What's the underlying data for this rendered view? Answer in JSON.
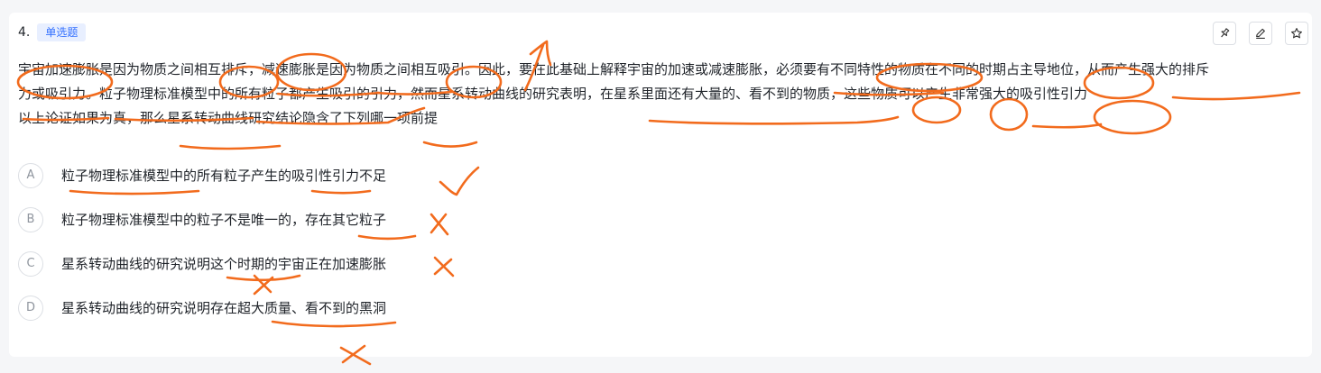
{
  "question": {
    "number": "4.",
    "type_tag": "单选题",
    "stem_lines": [
      "宇宙加速膨胀是因为物质之间相互排斥，减速膨胀是因为物质之间相互吸引。因此，要在此基础上解释宇宙的加速或减速膨胀，必须要有不同特性的物质在不同的时期占主导地位，从而产生强大的排斥",
      "力或吸引力。粒子物理标准模型中的所有粒子都产生吸引的引力，然而星系转动曲线的研究表明，在星系里面还有大量的、看不到的物质，这些物质可以产生非常强大的吸引性引力",
      "以上论证如果为真，那么星系转动曲线研究结论隐含了下列哪一项前提"
    ],
    "options": [
      {
        "letter": "A",
        "text": "粒子物理标准模型中的所有粒子产生的吸引性引力不足"
      },
      {
        "letter": "B",
        "text": "粒子物理标准模型中的粒子不是唯一的，存在其它粒子"
      },
      {
        "letter": "C",
        "text": "星系转动曲线的研究说明这个时期的宇宙正在加速膨胀"
      },
      {
        "letter": "D",
        "text": "星系转动曲线的研究说明存在超大质量、看不到的黑洞"
      }
    ]
  },
  "toolbar": {
    "icons": [
      "pin-icon",
      "edit-icon",
      "star-icon"
    ]
  },
  "colors": {
    "tag_text": "#3370ff",
    "tag_bg": "#e8efff",
    "annotation_ink": "#f26b1d"
  }
}
